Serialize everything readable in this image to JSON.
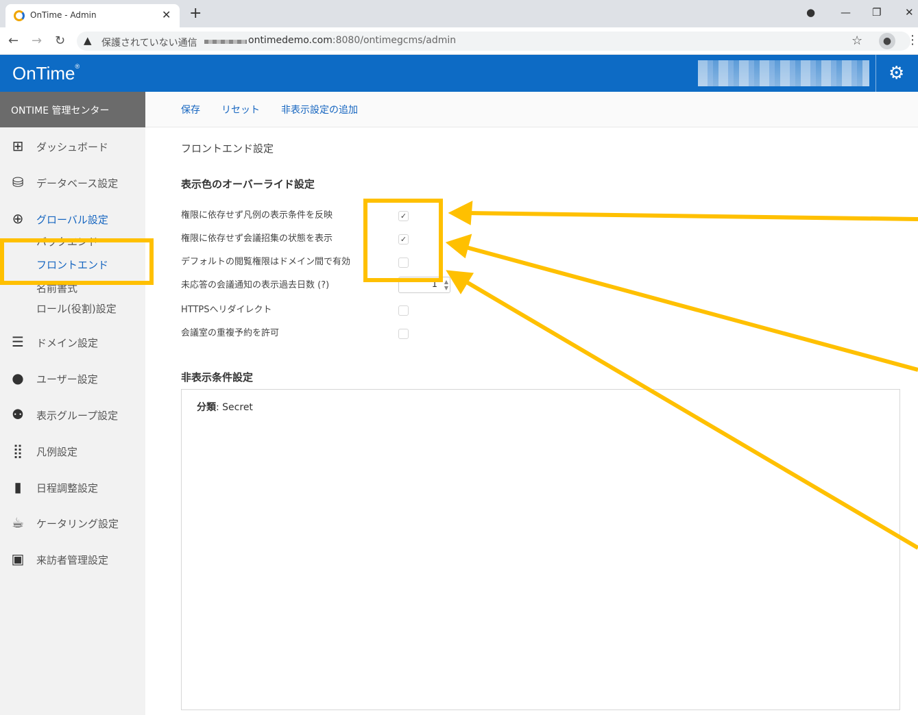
{
  "browser": {
    "tab_title": "OnTime - Admin",
    "tab_close": "✕",
    "new_tab": "+",
    "security_warning": "保護されていない通信",
    "url_host": "ontimedemo.com",
    "url_path": ":8080/ontimegcms/admin"
  },
  "header": {
    "logo": "OnTime",
    "logo_mark": "®"
  },
  "sidebar": {
    "title": "ONTIME 管理センター",
    "items": [
      {
        "label": "ダッシュボード"
      },
      {
        "label": "データベース設定"
      },
      {
        "label": "グローバル設定"
      },
      {
        "label": "ドメイン設定"
      },
      {
        "label": "ユーザー設定"
      },
      {
        "label": "表示グループ設定"
      },
      {
        "label": "凡例設定"
      },
      {
        "label": "日程調整設定"
      },
      {
        "label": "ケータリング設定"
      },
      {
        "label": "来訪者管理設定"
      }
    ],
    "sub_items": [
      {
        "label": "バックエンド"
      },
      {
        "label": "フロントエンド"
      },
      {
        "label": "名前書式"
      },
      {
        "label": "ロール(役割)設定"
      }
    ]
  },
  "toolbar": {
    "save": "保存",
    "reset": "リセット",
    "add_hidden": "非表示設定の追加"
  },
  "main": {
    "page_title": "フロントエンド設定",
    "color_override_title": "表示色のオーバーライド設定",
    "settings": [
      {
        "label": "権限に依存せず凡例の表示条件を反映",
        "checked": true,
        "mark": "✓"
      },
      {
        "label": "権限に依存せず会議招集の状態を表示",
        "checked": true,
        "mark": "✓"
      },
      {
        "label": "デフォルトの閲覧権限はドメイン間で有効",
        "checked": false,
        "mark": ""
      },
      {
        "label": "未応答の会議通知の表示過去日数 (?)",
        "value": "1"
      },
      {
        "label": "HTTPSへリダイレクト",
        "checked": false,
        "mark": ""
      },
      {
        "label": "会議室の重複予約を許可",
        "checked": false,
        "mark": ""
      }
    ],
    "hidden_conditions_title": "非表示条件設定",
    "hidden_conditions": [
      {
        "key": "分類",
        "value": ": Secret"
      }
    ]
  },
  "colors": {
    "brand_blue": "#0d6bc5",
    "highlight": "#ffc000"
  }
}
